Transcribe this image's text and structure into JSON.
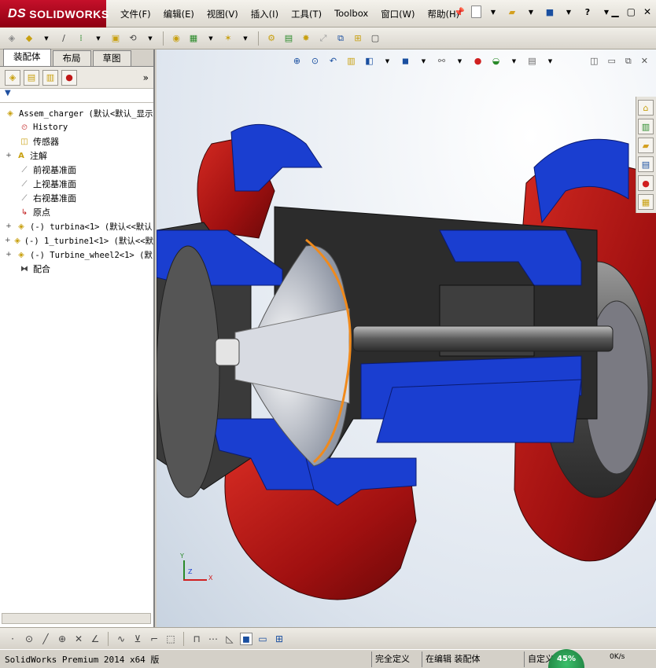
{
  "app": {
    "logo_prefix": "DS",
    "logo_text": "SOLIDWORKS"
  },
  "menu": [
    "文件(F)",
    "编辑(E)",
    "视图(V)",
    "插入(I)",
    "工具(T)",
    "Toolbox",
    "窗口(W)",
    "帮助(H)"
  ],
  "tabs": [
    "装配体",
    "布局",
    "草图"
  ],
  "tree": [
    {
      "label": "Assem_charger  (默认<默认_显示",
      "icon": "assembly-icon",
      "expand": "",
      "mono": true,
      "level": 0
    },
    {
      "label": "History",
      "icon": "history-icon",
      "expand": "",
      "mono": true,
      "level": 1
    },
    {
      "label": "传感器",
      "icon": "sensor-icon",
      "expand": "",
      "mono": false,
      "level": 1
    },
    {
      "label": "注解",
      "icon": "annotation-icon",
      "expand": "+",
      "mono": false,
      "level": 1
    },
    {
      "label": "前视基准面",
      "icon": "plane-icon",
      "expand": "",
      "mono": false,
      "level": 1
    },
    {
      "label": "上视基准面",
      "icon": "plane-icon",
      "expand": "",
      "mono": false,
      "level": 1
    },
    {
      "label": "右视基准面",
      "icon": "plane-icon",
      "expand": "",
      "mono": false,
      "level": 1
    },
    {
      "label": "原点",
      "icon": "origin-icon",
      "expand": "",
      "mono": false,
      "level": 1
    },
    {
      "label": "(-) turbina<1> (默认<<默认",
      "icon": "part-icon",
      "expand": "+",
      "mono": true,
      "level": 1
    },
    {
      "label": "(-) 1_turbine1<1> (默认<<默",
      "icon": "part-icon",
      "expand": "+",
      "mono": true,
      "level": 1
    },
    {
      "label": "(-) Turbine_wheel2<1> (默",
      "icon": "part-icon",
      "expand": "+",
      "mono": true,
      "level": 1
    },
    {
      "label": "配合",
      "icon": "mates-icon",
      "expand": "",
      "mono": false,
      "level": 1
    }
  ],
  "colors": {
    "housing_red": "#b01818",
    "section_blue": "#1a3ed0",
    "shaft_gray": "#5a5a5a",
    "ring_orange": "#f08a1c"
  },
  "triad": {
    "x": "X",
    "y": "Y",
    "z": "Z"
  },
  "status": {
    "version": "SolidWorks Premium 2014 x64 版",
    "definition": "完全定义",
    "editing": "在编辑 装配体",
    "custom": "自定义",
    "net_percent": "45%",
    "net_speed": "0K/s"
  }
}
